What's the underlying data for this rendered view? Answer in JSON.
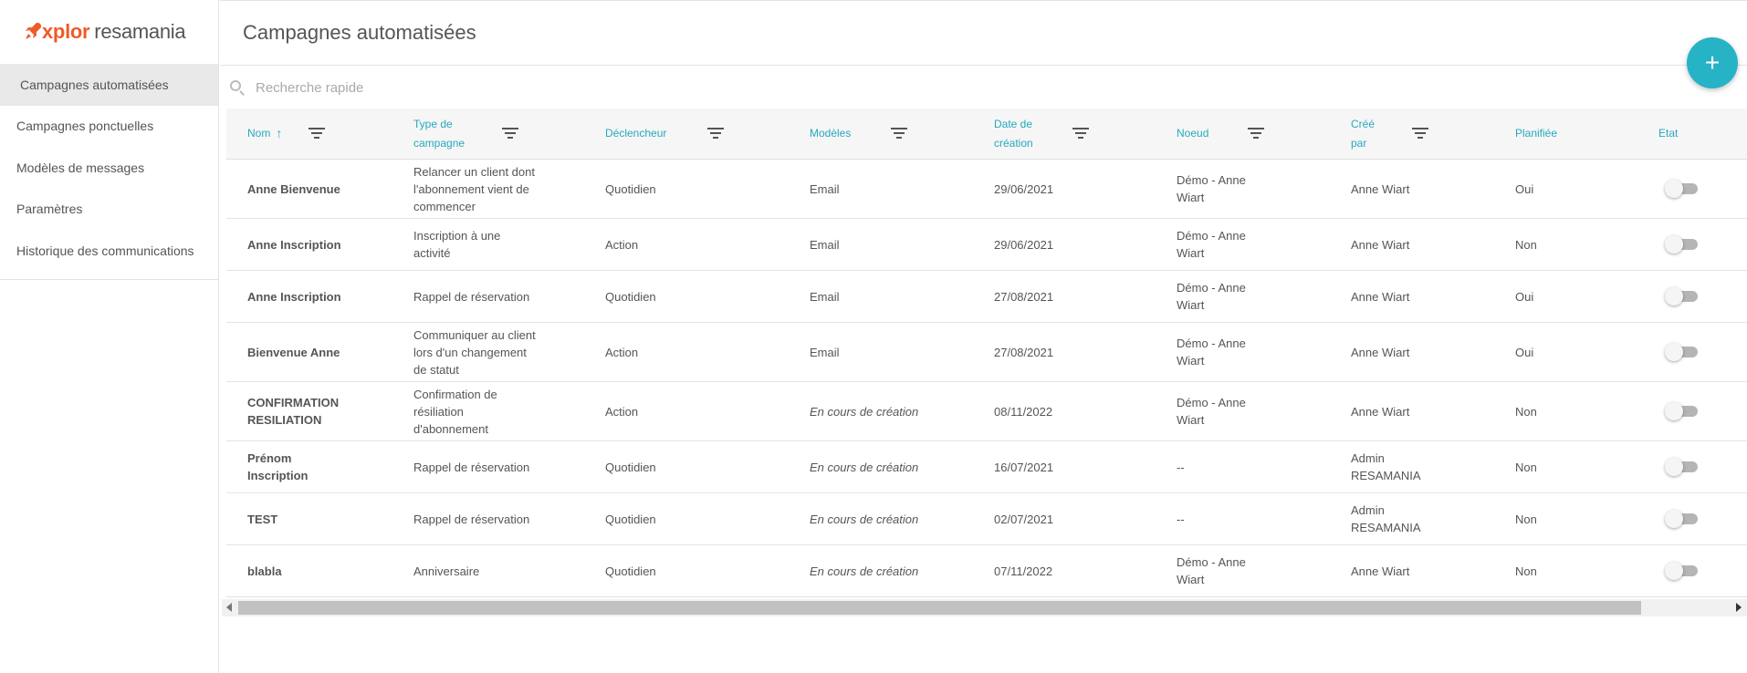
{
  "brand": {
    "logo_x": "xplor",
    "logo_name": "resamania"
  },
  "sidebar": {
    "items": [
      {
        "label": "Campagnes automatisées"
      },
      {
        "label": "Campagnes ponctuelles"
      },
      {
        "label": "Modèles de messages"
      },
      {
        "label": "Paramètres"
      },
      {
        "label": "Historique des communications"
      }
    ]
  },
  "header": {
    "title": "Campagnes automatisées",
    "add_label": "+"
  },
  "search": {
    "placeholder": "Recherche rapide"
  },
  "table": {
    "columns": {
      "nom": "Nom",
      "type": "Type de campagne",
      "declencheur": "Déclencheur",
      "modeles": "Modèles",
      "date": "Date de création",
      "noeud": "Noeud",
      "cree": "Créé par",
      "planifiee": "Planifiée",
      "etat": "Etat"
    },
    "sort_indicator": "↑",
    "rows": [
      {
        "nom": "Anne Bienvenue",
        "type": "Relancer un client dont l'abonnement vient de commencer",
        "declencheur": "Quotidien",
        "modeles": "Email",
        "date": "29/06/2021",
        "noeud": "Démo - Anne Wiart",
        "cree": "Anne Wiart",
        "planifiee": "Oui",
        "etat": false
      },
      {
        "nom": "Anne Inscription",
        "type": "Inscription à une activité",
        "declencheur": "Action",
        "modeles": "Email",
        "date": "29/06/2021",
        "noeud": "Démo - Anne Wiart",
        "cree": "Anne Wiart",
        "planifiee": "Non",
        "etat": false
      },
      {
        "nom": "Anne Inscription",
        "type": "Rappel de réservation",
        "declencheur": "Quotidien",
        "modeles": "Email",
        "date": "27/08/2021",
        "noeud": "Démo - Anne Wiart",
        "cree": "Anne Wiart",
        "planifiee": "Oui",
        "etat": false
      },
      {
        "nom": "Bienvenue Anne",
        "type": "Communiquer au client lors d'un changement de statut",
        "declencheur": "Action",
        "modeles": "Email",
        "date": "27/08/2021",
        "noeud": "Démo - Anne Wiart",
        "cree": "Anne Wiart",
        "planifiee": "Oui",
        "etat": false
      },
      {
        "nom": "CONFIRMATION RESILIATION",
        "type": "Confirmation de résiliation d'abonnement",
        "declencheur": "Action",
        "modeles": "En cours de création",
        "date": "08/11/2022",
        "noeud": "Démo - Anne Wiart",
        "cree": "Anne Wiart",
        "planifiee": "Non",
        "etat": false
      },
      {
        "nom": "Prénom Inscription",
        "type": "Rappel de réservation",
        "declencheur": "Quotidien",
        "modeles": "En cours de création",
        "date": "16/07/2021",
        "noeud": "--",
        "cree": "Admin RESAMANIA",
        "planifiee": "Non",
        "etat": false
      },
      {
        "nom": "TEST",
        "type": "Rappel de réservation",
        "declencheur": "Quotidien",
        "modeles": "En cours de création",
        "date": "02/07/2021",
        "noeud": "--",
        "cree": "Admin RESAMANIA",
        "planifiee": "Non",
        "etat": false
      },
      {
        "nom": "blabla",
        "type": "Anniversaire",
        "declencheur": "Quotidien",
        "modeles": "En cours de création",
        "date": "07/11/2022",
        "noeud": "Démo - Anne Wiart",
        "cree": "Anne Wiart",
        "planifiee": "Non",
        "etat": false
      }
    ]
  },
  "colors": {
    "accent": "#26b3c6",
    "brand_orange": "#f05a28"
  }
}
